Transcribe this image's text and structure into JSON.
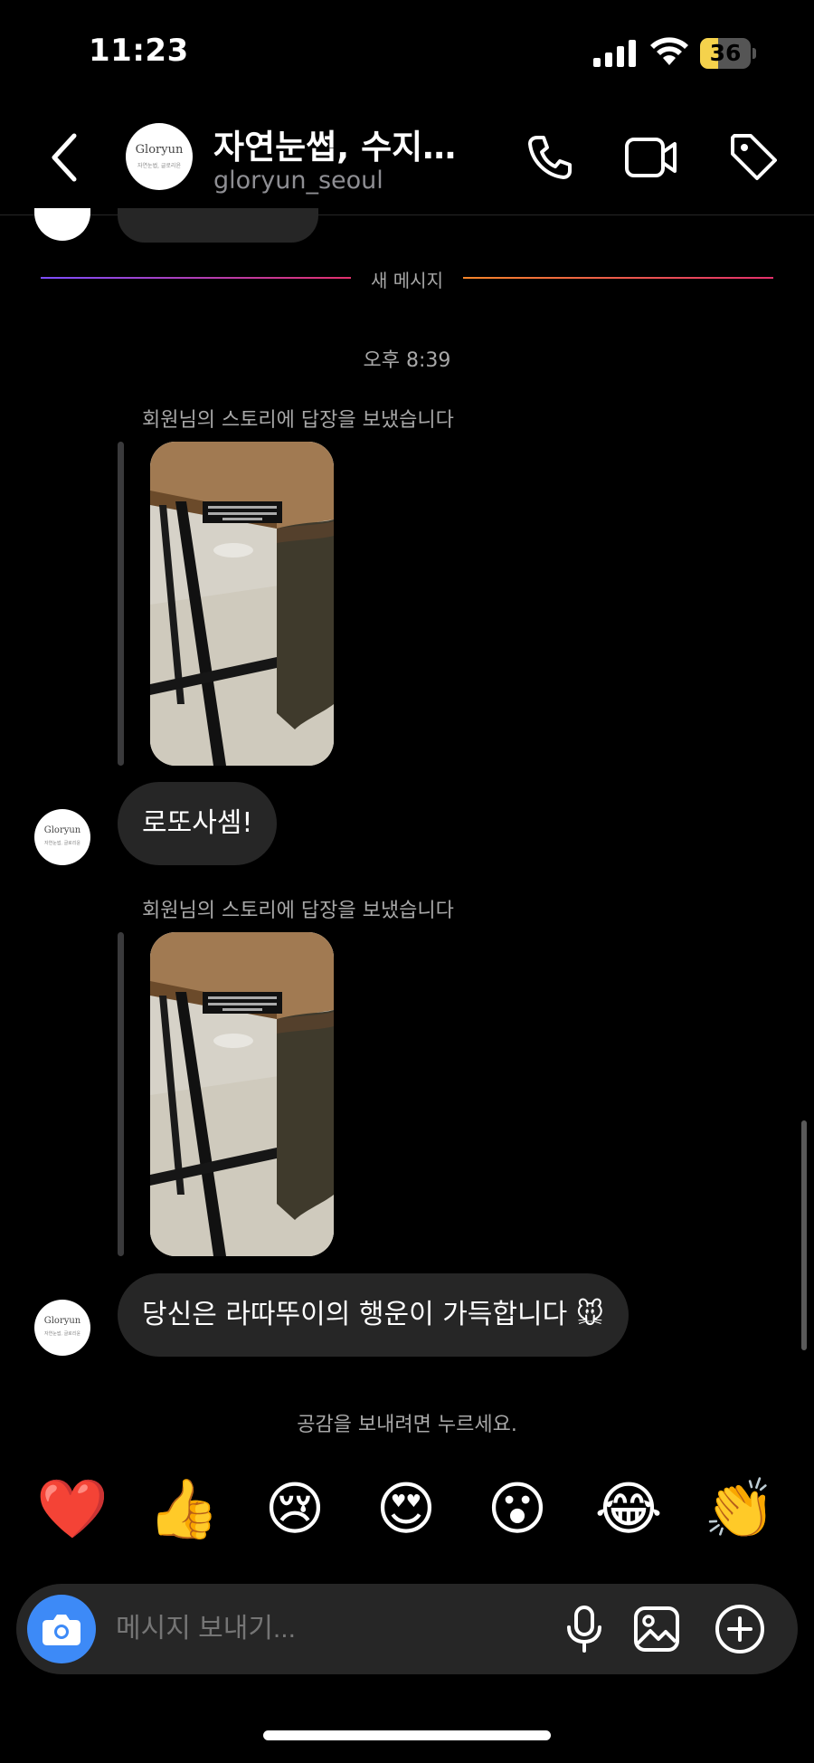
{
  "status_bar": {
    "time": "11:23",
    "battery": "36",
    "battery_level": 0.36,
    "icons": [
      "cellular-signal-icon",
      "wifi-icon",
      "battery-icon"
    ]
  },
  "header": {
    "title": "자연눈썹, 수지…",
    "subtitle": "gloryun_seoul",
    "avatar_logo": "Gloryun",
    "avatar_logo_sub": "자연눈썹, 글로리윤",
    "icons": [
      "back-chevron-icon",
      "phone-icon",
      "video-camera-icon",
      "tag-icon"
    ]
  },
  "divider": {
    "new_message": "새 메시지"
  },
  "thread": {
    "timestamp": "오후 8:39",
    "messages": [
      {
        "reply_label": "회원님의 스토리에 답장을 보냈습니다",
        "text": "로또사셈!"
      },
      {
        "reply_label": "회원님의 스토리에 답장을 보냈습니다",
        "text": "당신은 라따뚜이의 행운이 가득합니다 🐭"
      }
    ]
  },
  "reactions": {
    "hint": "공감을 보내려면 누르세요.",
    "emojis": [
      "❤️",
      "👍",
      "😢",
      "😍",
      "😮",
      "😂",
      "👏"
    ]
  },
  "composer": {
    "placeholder": "메시지 보내기...",
    "icons": [
      "camera-icon",
      "microphone-icon",
      "gallery-icon",
      "plus-circle-icon"
    ]
  },
  "colors": {
    "background": "#000000",
    "bubble": "#262626",
    "secondary_text": "#a8a8a8",
    "camera_button": "#3d8af7",
    "battery_fill": "#f5d24c"
  }
}
